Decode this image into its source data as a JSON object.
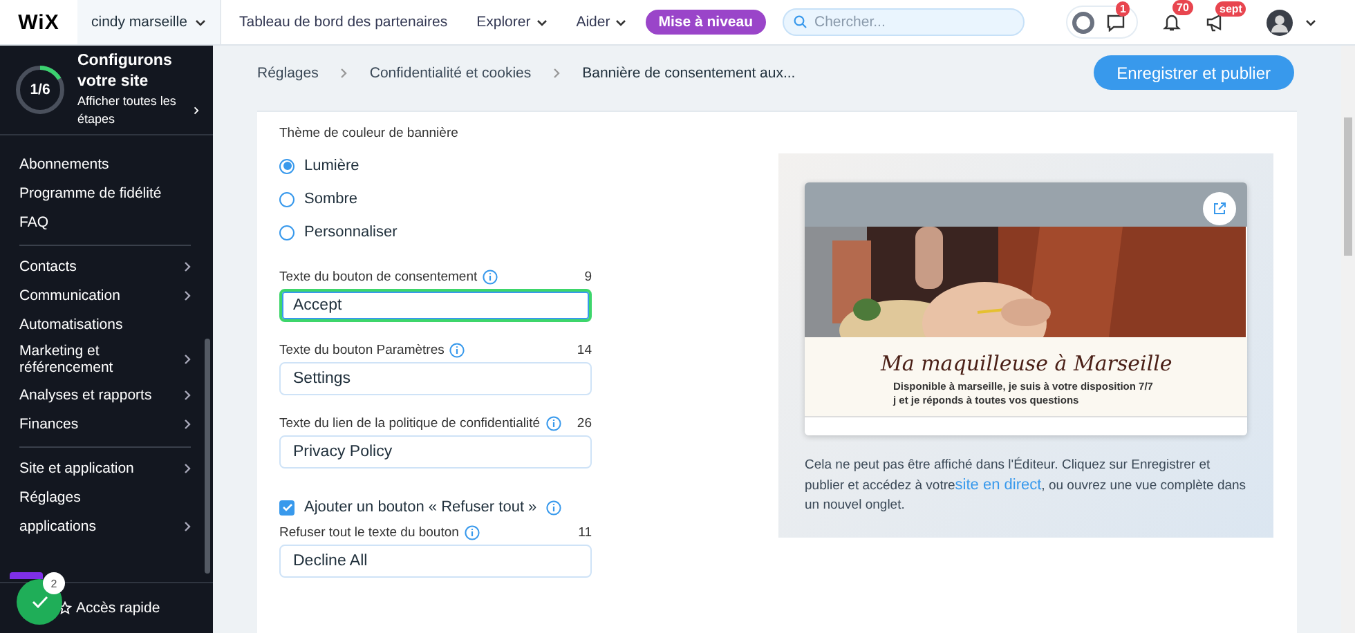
{
  "topbar": {
    "logo": "WiX",
    "site": "cindy marseille",
    "nav": [
      {
        "label": "Tableau de bord des partenaires",
        "dropdown": false
      },
      {
        "label": "Explorer",
        "dropdown": true
      },
      {
        "label": "Aider",
        "dropdown": true
      }
    ],
    "upgrade": "Mise à niveau",
    "search": {
      "placeholder": "Chercher..."
    },
    "badges": {
      "chat": "1",
      "bell": "70",
      "news": "sept"
    }
  },
  "setup": {
    "progress": "1/6",
    "level": 0.1667,
    "title": "Configurons votre site",
    "link": "Afficher toutes les étapes"
  },
  "sidebar": {
    "groups": [
      [
        {
          "label": "Abonnements",
          "expandable": false
        },
        {
          "label": "Programme de fidélité",
          "expandable": false
        },
        {
          "label": "FAQ",
          "expandable": false
        }
      ],
      [
        {
          "label": "Contacts",
          "expandable": true
        },
        {
          "label": "Communication",
          "expandable": true
        },
        {
          "label": "Automatisations",
          "expandable": false
        },
        {
          "label": "Marketing et référencement",
          "expandable": true
        },
        {
          "label": "Analyses et rapports",
          "expandable": true
        },
        {
          "label": "Finances",
          "expandable": true
        }
      ],
      [
        {
          "label": "Site et application",
          "expandable": true
        },
        {
          "label": "Réglages",
          "expandable": false
        },
        {
          "label": "applications",
          "expandable": true
        }
      ]
    ],
    "quick_access": "Accès rapide",
    "tasks_badge": "2"
  },
  "breadcrumb": [
    "Réglages",
    "Confidentialité et cookies",
    "Bannière de consentement aux..."
  ],
  "save_button": "Enregistrer et publier",
  "form": {
    "theme_label": "Thème de couleur de bannière",
    "themes": [
      {
        "label": "Lumière",
        "selected": true
      },
      {
        "label": "Sombre",
        "selected": false
      },
      {
        "label": "Personnaliser",
        "selected": false
      }
    ],
    "items": [
      {
        "kind": "field",
        "label": "Texte du bouton de consentement",
        "count": "9",
        "value": "Accept",
        "focused": true
      },
      {
        "kind": "field",
        "label": "Texte du bouton Paramètres",
        "count": "14",
        "value": "Settings",
        "focused": false
      },
      {
        "kind": "field",
        "label": "Texte du lien de la politique de confidentialité",
        "count": "26",
        "value": "Privacy Policy",
        "focused": false
      },
      {
        "kind": "checkbox",
        "label": "Ajouter un bouton « Refuser tout »",
        "checked": true
      },
      {
        "kind": "field",
        "label": "Refuser tout le texte du bouton",
        "count": "11",
        "value": "Decline All",
        "focused": false
      }
    ]
  },
  "preview": {
    "site_title": "Ma maquilleuse à Marseille",
    "site_text": "Disponible à marseille, je suis à votre disposition 7/7 j et je réponds à toutes vos questions",
    "note_before": "Cela ne peut pas être affiché dans l'Éditeur. Cliquez sur Enregistrer et publier et accédez à votre",
    "note_link": "site en direct",
    "note_after": ", ou ouvrez une vue complète dans un nouvel onglet."
  }
}
